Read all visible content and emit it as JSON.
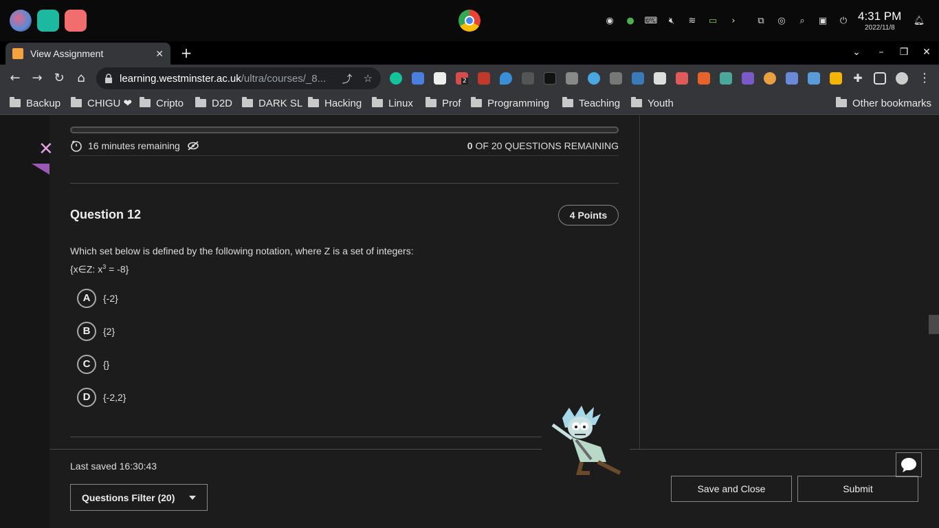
{
  "os": {
    "time": "4:31 PM",
    "date": "2022/11/8"
  },
  "browser": {
    "tab_title": "View Assignment",
    "url_host": "learning.westminster.ac.uk",
    "url_path": "/ultra/courses/_8...",
    "extension_badge": "2",
    "bookmarks": [
      "Backup",
      "CHIGU ❤",
      "Cripto",
      "D2D",
      "DARK SL",
      "Hacking",
      "Linux",
      "Prof",
      "Programming",
      "Teaching",
      "Youth"
    ],
    "other_bookmarks": "Other bookmarks"
  },
  "assessment": {
    "timer_text": "16 minutes remaining",
    "remaining_count": "0",
    "remaining_label": "OF 20 QUESTIONS REMAINING",
    "question_title": "Question 12",
    "points": "4 Points",
    "question_line1": "Which set below is defined by the following notation, where Z is a set of integers:",
    "question_line2_prefix": "{x∈Z: x",
    "question_line2_sup": "3",
    "question_line2_suffix": " = -8}",
    "options": [
      {
        "letter": "A",
        "text": "{-2}"
      },
      {
        "letter": "B",
        "text": "{2}"
      },
      {
        "letter": "C",
        "text": "{}"
      },
      {
        "letter": "D",
        "text": "{-2,2}"
      }
    ],
    "last_saved": "Last saved 16:30:43",
    "filter_label": "Questions Filter (20)",
    "save_close_label": "Save and Close",
    "submit_label": "Submit"
  },
  "colors": {
    "page_bg": "#1c1c1c",
    "accent_purple": "#9b59b6",
    "close_x": "#e0a0e0"
  }
}
